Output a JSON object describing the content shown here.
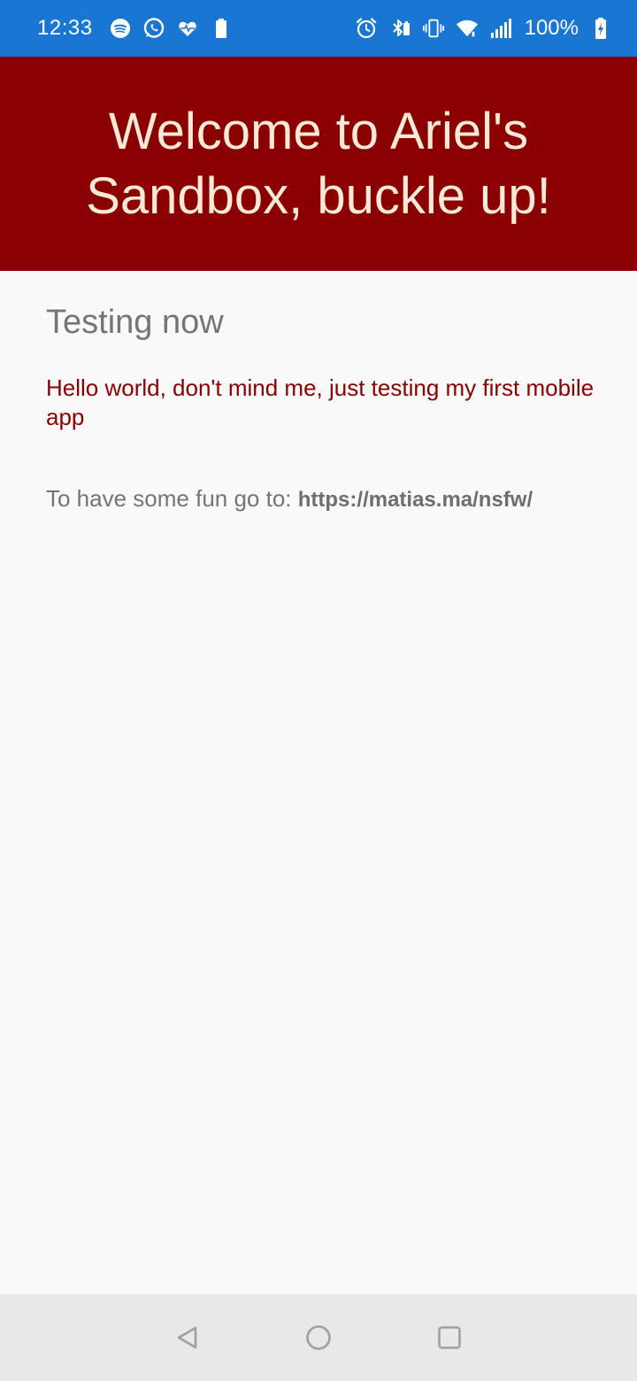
{
  "status_bar": {
    "time": "12:33",
    "battery": "100%",
    "left_icons": [
      "spotify-icon",
      "whatsapp-icon",
      "health-icon",
      "battery-saver-icon"
    ],
    "right_icons": [
      "alarm-icon",
      "bluetooth-icon",
      "vibrate-icon",
      "wifi-icon",
      "signal-icon",
      "battery-charging-icon"
    ],
    "color": "#1976d2"
  },
  "header": {
    "title": "Welcome to Ariel's Sandbox, buckle up!",
    "background": "#8b0000",
    "text_color": "#fbe9d7"
  },
  "main": {
    "section_title": "Testing now",
    "hello_text": "Hello world, don't mind me, just testing my first mobile app",
    "fun_prefix": "To have some fun go to:",
    "fun_link": "https://matias.ma/nsfw/"
  },
  "nav_bar": {
    "buttons": [
      "back-icon",
      "home-icon",
      "recents-icon"
    ]
  }
}
